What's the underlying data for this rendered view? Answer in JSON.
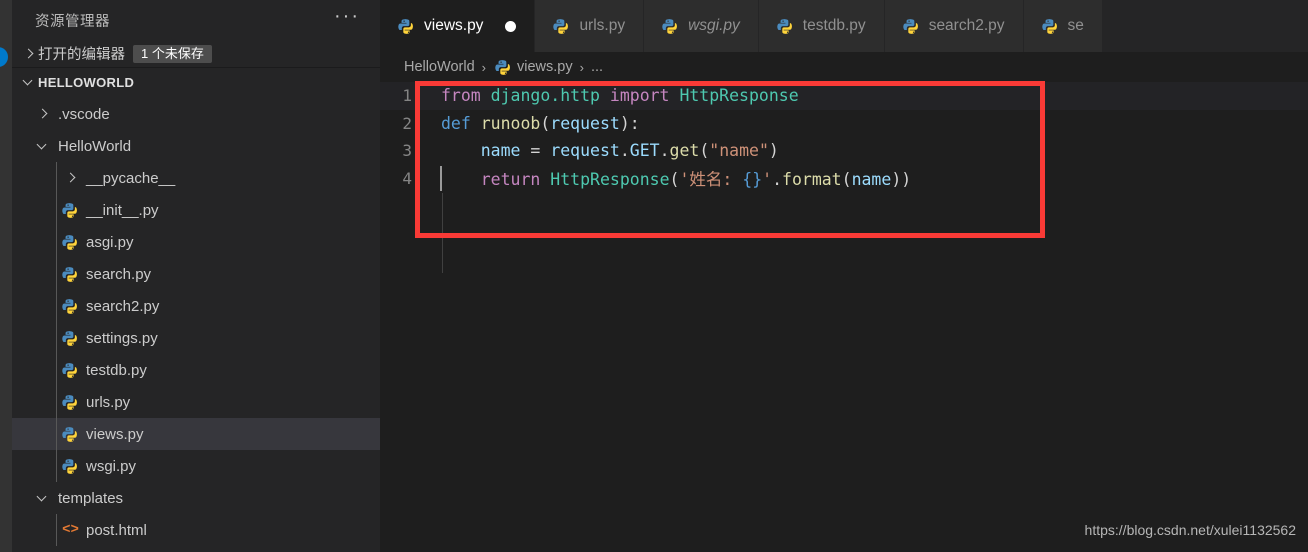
{
  "window": {
    "background": "#1e1e1e",
    "accent": "#007acc",
    "annotation_color": "#f93a36"
  },
  "activity_bar": {
    "badge_label": ""
  },
  "sidebar": {
    "title": "资源管理器",
    "more_icon": "···",
    "open_editors": {
      "label": "打开的编辑器",
      "badge": "1 个未保存",
      "expanded": false
    },
    "workspace": {
      "label": "HELLOWORLD",
      "expanded": true
    },
    "tree": [
      {
        "name": ".vscode",
        "icon": "folder",
        "indent": 1,
        "expanded": false,
        "selected": false
      },
      {
        "name": "HelloWorld",
        "icon": "folder",
        "indent": 1,
        "expanded": true,
        "selected": false
      },
      {
        "name": "__pycache__",
        "icon": "folder",
        "indent": 2,
        "expanded": false,
        "selected": false
      },
      {
        "name": "__init__.py",
        "icon": "python-icon",
        "indent": 2,
        "selected": false
      },
      {
        "name": "asgi.py",
        "icon": "python-icon",
        "indent": 2,
        "selected": false
      },
      {
        "name": "search.py",
        "icon": "python-icon",
        "indent": 2,
        "selected": false
      },
      {
        "name": "search2.py",
        "icon": "python-icon",
        "indent": 2,
        "selected": false
      },
      {
        "name": "settings.py",
        "icon": "python-icon",
        "indent": 2,
        "selected": false
      },
      {
        "name": "testdb.py",
        "icon": "python-icon",
        "indent": 2,
        "selected": false
      },
      {
        "name": "urls.py",
        "icon": "python-icon",
        "indent": 2,
        "selected": false
      },
      {
        "name": "views.py",
        "icon": "python-icon",
        "indent": 2,
        "selected": true
      },
      {
        "name": "wsgi.py",
        "icon": "python-icon",
        "indent": 2,
        "selected": false
      },
      {
        "name": "templates",
        "icon": "folder",
        "indent": 1,
        "expanded": true,
        "selected": false
      },
      {
        "name": "post.html",
        "icon": "html-icon",
        "indent": 2,
        "selected": false
      }
    ]
  },
  "editor": {
    "tabs": [
      {
        "label": "views.py",
        "icon": "python-icon",
        "active": true,
        "dirty": true,
        "preview": false
      },
      {
        "label": "urls.py",
        "icon": "python-icon",
        "active": false,
        "dirty": false,
        "preview": false
      },
      {
        "label": "wsgi.py",
        "icon": "python-icon",
        "active": false,
        "dirty": false,
        "preview": true
      },
      {
        "label": "testdb.py",
        "icon": "python-icon",
        "active": false,
        "dirty": false,
        "preview": false
      },
      {
        "label": "search2.py",
        "icon": "python-icon",
        "active": false,
        "dirty": false,
        "preview": false
      },
      {
        "label": "se",
        "icon": "python-icon",
        "active": false,
        "dirty": false,
        "preview": false
      }
    ],
    "breadcrumb": {
      "root": "HelloWorld",
      "file": "views.py",
      "file_icon": "python-icon",
      "trailing": "...",
      "separator": "›"
    },
    "language": "python",
    "lines": [
      {
        "number": "1",
        "current": true,
        "tokens": [
          {
            "t": "from ",
            "c": "tok-kw"
          },
          {
            "t": "django.http",
            "c": "tok-type"
          },
          {
            "t": " ",
            "c": "tok-plain"
          },
          {
            "t": "import",
            "c": "tok-kw"
          },
          {
            "t": " ",
            "c": "tok-plain"
          },
          {
            "t": "HttpResponse",
            "c": "tok-type"
          }
        ]
      },
      {
        "number": "2",
        "current": false,
        "tokens": [
          {
            "t": "def ",
            "c": "tok-def"
          },
          {
            "t": "runoob",
            "c": "tok-func"
          },
          {
            "t": "(",
            "c": "tok-plain"
          },
          {
            "t": "request",
            "c": "tok-var"
          },
          {
            "t": "):",
            "c": "tok-plain"
          }
        ]
      },
      {
        "number": "3",
        "current": false,
        "tokens": [
          {
            "t": "    ",
            "c": "tok-plain"
          },
          {
            "t": "name",
            "c": "tok-var"
          },
          {
            "t": " = ",
            "c": "tok-plain"
          },
          {
            "t": "request",
            "c": "tok-var"
          },
          {
            "t": ".",
            "c": "tok-plain"
          },
          {
            "t": "GET",
            "c": "tok-var"
          },
          {
            "t": ".",
            "c": "tok-plain"
          },
          {
            "t": "get",
            "c": "tok-func"
          },
          {
            "t": "(",
            "c": "tok-plain"
          },
          {
            "t": "\"name\"",
            "c": "tok-str"
          },
          {
            "t": ")",
            "c": "tok-plain"
          }
        ]
      },
      {
        "number": "4",
        "current": false,
        "tokens": [
          {
            "t": "    ",
            "c": "tok-plain"
          },
          {
            "t": "return ",
            "c": "tok-kw"
          },
          {
            "t": "HttpResponse",
            "c": "tok-type"
          },
          {
            "t": "(",
            "c": "tok-plain"
          },
          {
            "t": "'姓名: ",
            "c": "tok-str"
          },
          {
            "t": "{}",
            "c": "tok-brace"
          },
          {
            "t": "'",
            "c": "tok-str"
          },
          {
            "t": ".",
            "c": "tok-plain"
          },
          {
            "t": "format",
            "c": "tok-func"
          },
          {
            "t": "(",
            "c": "tok-plain"
          },
          {
            "t": "name",
            "c": "tok-var"
          },
          {
            "t": "))",
            "c": "tok-plain"
          }
        ]
      }
    ]
  },
  "watermark": "https://blog.csdn.net/xulei1132562"
}
